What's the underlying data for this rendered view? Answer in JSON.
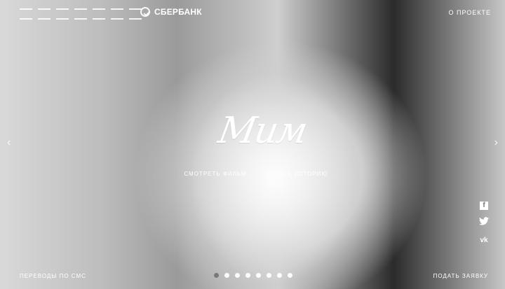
{
  "header": {
    "brand_left_label": "STREETS",
    "brand_sber_label": "СБЕРБАНК",
    "about_label": "О ПРОЕКТЕ"
  },
  "hero": {
    "title": "Мим",
    "action_watch": "СМОТРЕТЬ ФИЛЬМ",
    "action_read": "ЧИТАТЬ ИСТОРИЮ"
  },
  "footer": {
    "sms_label": "ПЕРЕВОДЫ ПО СМС",
    "apply_label": "ПОДАТЬ ЗАЯВКУ"
  },
  "carousel": {
    "active_index": 0,
    "total": 8,
    "active_color": "#2f8f3a"
  },
  "social": [
    {
      "name": "facebook-icon",
      "glyph": "f"
    },
    {
      "name": "twitter-icon",
      "glyph": ""
    },
    {
      "name": "vk-icon",
      "glyph": "vk"
    }
  ]
}
